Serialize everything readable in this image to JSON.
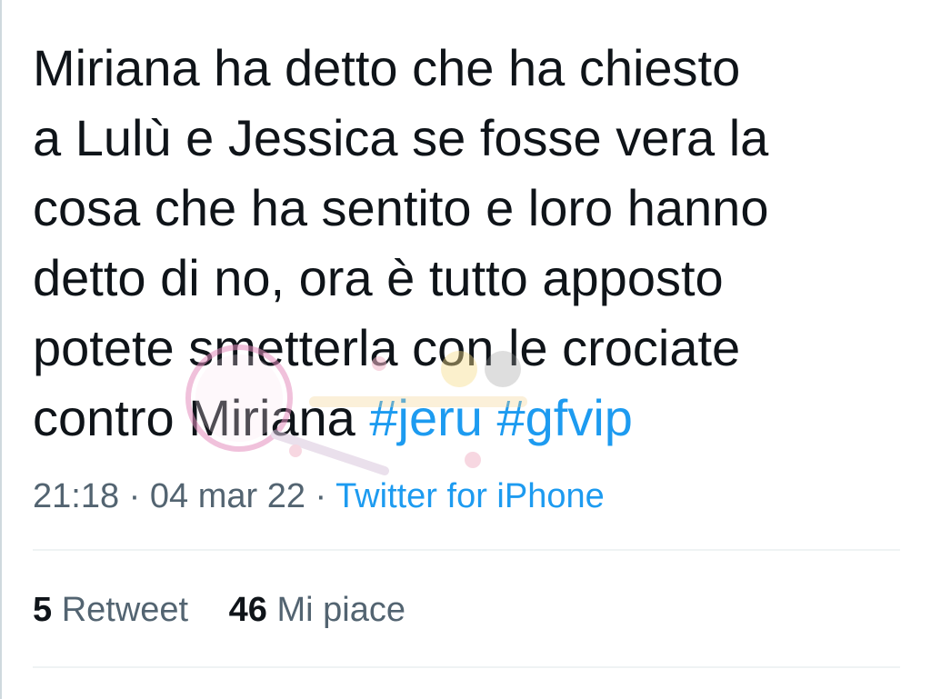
{
  "tweet": {
    "lines": [
      "Miriana ha detto che ha chiesto",
      "a Lulù e Jessica se fosse vera la",
      "cosa che ha sentito e loro hanno",
      "detto di no, ora è tutto apposto",
      "potete smetterla con le crociate",
      "contro Miriana "
    ],
    "hashtags": [
      "#jeru",
      "#gfvip"
    ]
  },
  "meta": {
    "time": "21:18",
    "separator": " · ",
    "date": "04 mar 22",
    "source": "Twitter for iPhone"
  },
  "stats": {
    "retweet_count": "5",
    "retweet_label": "Retweet",
    "like_count": "46",
    "like_label": "Mi piace"
  },
  "colors": {
    "text": "#0f1419",
    "secondary": "#536471",
    "link": "#1d9bf0",
    "divider": "#eff3f4"
  },
  "watermark": {
    "icon": "magnifier-watermark-icon"
  }
}
